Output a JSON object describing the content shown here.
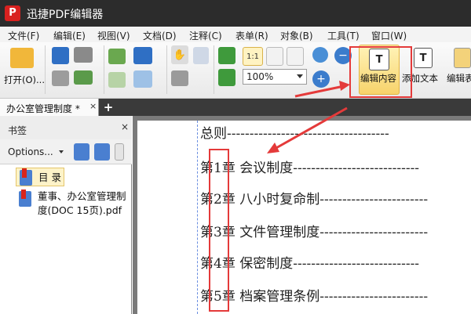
{
  "window": {
    "title": "迅捷PDF编辑器"
  },
  "menu": [
    "文件(F)",
    "编辑(E)",
    "视图(V)",
    "文档(D)",
    "注释(C)",
    "表单(R)",
    "对象(B)",
    "工具(T)",
    "窗口(W)"
  ],
  "toolbar": {
    "open_label": "打开(O)...",
    "zoom_value": "100%",
    "edit_content_label": "编辑内容",
    "add_text_label": "添加文本",
    "edit_form_label": "编辑表"
  },
  "tabs": {
    "active": "办公室管理制度 *",
    "close": "×",
    "new": "+"
  },
  "sidebar": {
    "title": "书签",
    "close": "×",
    "options_label": "Options...",
    "bookmarks": [
      {
        "label": "目 录"
      },
      {
        "label_line1": "董事、办公室管理制",
        "label_line2": "度(DOC 15页).pdf"
      }
    ]
  },
  "document": {
    "toc": [
      "总则------------------------------------",
      "第1章  会议制度----------------------------",
      "第2章  八小时复命制------------------------",
      "第3章  文件管理制度------------------------",
      "第4章  保密制度----------------------------",
      "第5章  档案管理条例------------------------"
    ]
  },
  "colors": {
    "annotation": "#e43a3a",
    "titlebar": "#2c2c2c",
    "highlight": "#f7d36b"
  }
}
